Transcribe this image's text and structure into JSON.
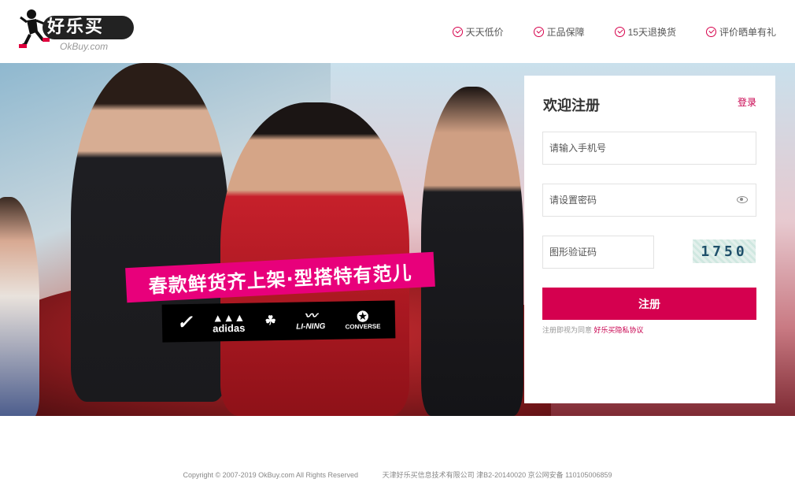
{
  "header": {
    "brand_name": "好乐买",
    "brand_domain": "OkBuy.com",
    "promises": [
      "天天低价",
      "正品保障",
      "15天退换货",
      "评价晒单有礼"
    ]
  },
  "banner": {
    "slogan": "春款鲜货齐上架·型搭特有范儿",
    "brand_logos": [
      "NIKE",
      "adidas",
      "adidas Originals",
      "LI-NING",
      "CONVERSE"
    ]
  },
  "register": {
    "title": "欢迎注册",
    "login_link": "登录",
    "phone_placeholder": "请输入手机号",
    "password_placeholder": "请设置密码",
    "captcha_placeholder": "图形验证码",
    "captcha_code": "1750",
    "submit_label": "注册",
    "agree_prefix": "注册即视为同意",
    "agree_link": "好乐买隐私协议"
  },
  "footer": {
    "copyright": "Copyright © 2007-2019 OkBuy.com All Rights Reserved",
    "company": "天津好乐买信息技术有限公司 津B2-20140020 京公网安备 110105006859"
  },
  "colors": {
    "accent": "#d5004f",
    "slogan_bg": "#e8007b"
  }
}
